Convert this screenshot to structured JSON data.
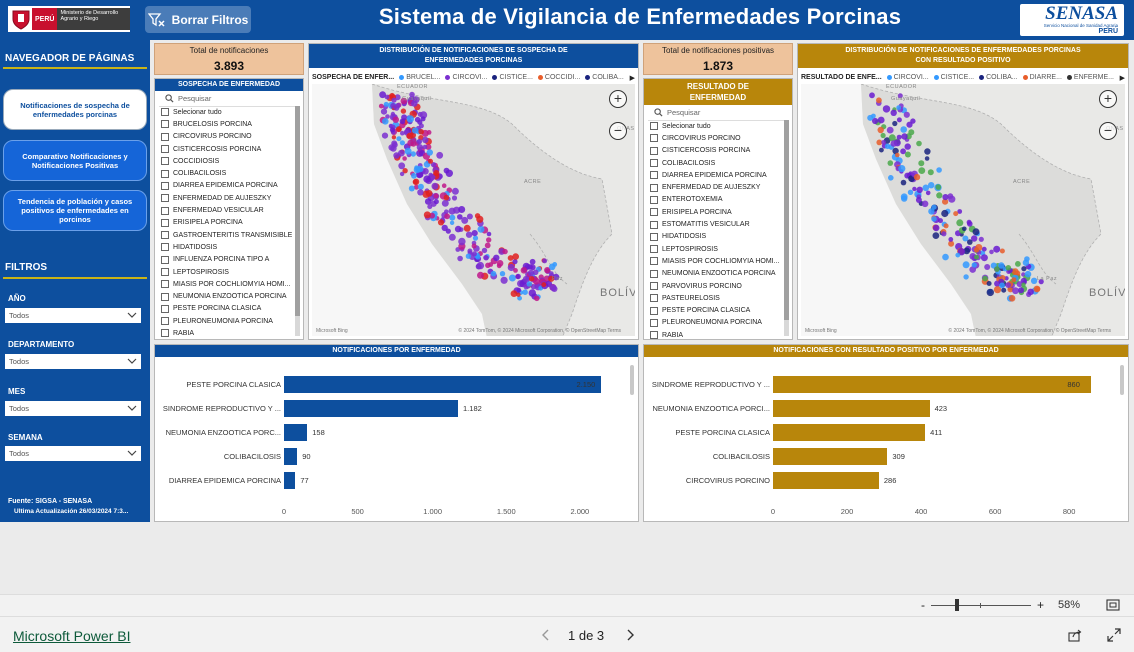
{
  "header": {
    "title": "Sistema de Vigilancia de Enfermedades Porcinas",
    "clear_filters": "Borrar Filtros",
    "gov_logo": {
      "country": "PERÚ",
      "ministry": "Ministerio de Desarrollo Agrario y Riego"
    },
    "senasa_logo": {
      "name": "SENASA",
      "subtitle": "Servicio Nacional de Sanidad Agraria",
      "country": "PERÚ"
    }
  },
  "sidebar": {
    "nav_heading": "NAVEGADOR DE PÁGINAS",
    "nav_items": [
      {
        "label": "Notificaciones de sospecha de enfermedades porcinas",
        "active": true
      },
      {
        "label": "Comparativo Notificaciones y Notificaciones Positivas",
        "active": false
      },
      {
        "label": "Tendencia de población y casos positivos de enfermedades en porcinos",
        "active": false
      }
    ],
    "filters_heading": "FILTROS",
    "filters": [
      {
        "label": "AÑO",
        "value": "Todos"
      },
      {
        "label": "DEPARTAMENTO",
        "value": "Todos"
      },
      {
        "label": "MES",
        "value": "Todos"
      },
      {
        "label": "SEMANA",
        "value": "Todos"
      }
    ],
    "source": "Fuente: SIGSA - SENASA",
    "last_update": "Última Actualización 26/03/2024 7:3..."
  },
  "kpis": {
    "total": {
      "label": "Total de notificaciones",
      "value": "3.893"
    },
    "positive": {
      "label": "Total de notificaciones positivas",
      "value": "1.873"
    }
  },
  "slicer_suspect": {
    "title": "SOSPECHA DE ENFERMEDAD",
    "search_placeholder": "Pesquisar",
    "items": [
      "Selecionar tudo",
      "BRUCELOSIS PORCINA",
      "CIRCOVIRUS PORCINO",
      "CISTICERCOSIS PORCINA",
      "COCCIDIOSIS",
      "COLIBACILOSIS",
      "DIARREA EPIDEMICA PORCINA",
      "ENFERMEDAD DE AUJESZKY",
      "ENFERMEDAD VESICULAR",
      "ERISIPELA PORCINA",
      "GASTROENTERITIS TRANSMISIBLE",
      "HIDATIDOSIS",
      "INFLUENZA PORCINA TIPO A",
      "LEPTOSPIROSIS",
      "MIASIS POR COCHLIOMYIA HOMI...",
      "NEUMONIA ENZOOTICA PORCINA",
      "PESTE PORCINA CLASICA",
      "PLEURONEUMONIA PORCINA",
      "RABIA"
    ]
  },
  "slicer_result": {
    "title": "RESULTADO DE ENFERMEDAD",
    "search_placeholder": "Pesquisar",
    "items": [
      "Selecionar tudo",
      "CIRCOVIRUS PORCINO",
      "CISTICERCOSIS PORCINA",
      "COLIBACILOSIS",
      "DIARREA EPIDEMICA PORCINA",
      "ENFERMEDAD DE AUJESZKY",
      "ENTEROTOXEMIA",
      "ERISIPELA PORCINA",
      "ESTOMATITIS VESICULAR",
      "HIDATIDOSIS",
      "LEPTOSPIROSIS",
      "MIASIS POR COCHLIOMYIA HOMI...",
      "NEUMONIA ENZOOTICA PORCINA",
      "PARVOVIRUS PORCINO",
      "PASTEURELOSIS",
      "PESTE PORCINA CLASICA",
      "PLEURONEUMONIA PORCINA",
      "RABIA"
    ]
  },
  "map_suspect": {
    "title": "DISTRIBUCIÓN DE NOTIFICACIONES DE SOSPECHA DE ENFERMEDADES PORCINAS",
    "legend_title": "SOSPECHA DE ENFER...",
    "legend": [
      {
        "name": "BRUCEL...",
        "color": "#3399ff"
      },
      {
        "name": "CIRCOVI...",
        "color": "#7b2fd0"
      },
      {
        "name": "CISTICE...",
        "color": "#1a237e"
      },
      {
        "name": "COCCIDI...",
        "color": "#e85d2a"
      },
      {
        "name": "COLIBA...",
        "color": "#1a237e"
      }
    ],
    "labels": {
      "country_n": "ECUADOR",
      "city_n": "Guayaquil",
      "country_e": "BOLÍV",
      "region": "ACRE",
      "region2": "ONAS",
      "city_s": "Paz"
    },
    "bing": "Microsoft Bing",
    "credits": "© 2024 TomTom, © 2024 Microsoft Corporation, © OpenStreetMap  Terms"
  },
  "map_result": {
    "title": "DISTRIBUCIÓN DE NOTIFICACIONES DE ENFERMEDADES PORCINAS CON RESULTADO POSITIVO",
    "legend_title": "RESULTADO DE ENFE...",
    "legend": [
      {
        "name": "CIRCOVI...",
        "color": "#3399ff"
      },
      {
        "name": "CISTICE...",
        "color": "#3399ff"
      },
      {
        "name": "COLIBA...",
        "color": "#1a237e"
      },
      {
        "name": "DIARRE...",
        "color": "#e85d2a"
      },
      {
        "name": "ENFERME...",
        "color": "#333333"
      }
    ],
    "labels": {
      "country_n": "ECUADOR",
      "city_n": "Guayaquil",
      "country_e": "BOLÍV",
      "region": "ACRE",
      "region2": "ONAS",
      "city_s": "La Paz"
    },
    "bing": "Microsoft Bing",
    "credits": "© 2024 TomTom, © 2024 Microsoft Corporation, © OpenStreetMap  Terms"
  },
  "chart_data": [
    {
      "type": "bar",
      "orientation": "horizontal",
      "title": "NOTIFICACIONES POR ENFERMEDAD",
      "categories": [
        "PESTE PORCINA CLASICA",
        "SINDROME REPRODUCTIVO Y ...",
        "NEUMONIA ENZOOTICA PORC...",
        "COLIBACILOSIS",
        "DIARREA EPIDEMICA PORCINA"
      ],
      "values": [
        2150,
        1182,
        158,
        90,
        77
      ],
      "value_labels": [
        "2.150",
        "1.182",
        "158",
        "90",
        "77"
      ],
      "xlim": [
        0,
        2350
      ],
      "ticks": [
        0,
        500,
        1000,
        1500,
        2000
      ],
      "tick_labels": [
        "0",
        "500",
        "1.000",
        "1.500",
        "2.000"
      ],
      "color": "#0d4f9e"
    },
    {
      "type": "bar",
      "orientation": "horizontal",
      "title": "NOTIFICACIONES CON RESULTADO POSITIVO POR ENFERMEDAD",
      "categories": [
        "SINDROME REPRODUCTIVO Y ...",
        "NEUMONIA ENZOOTICA PORCI...",
        "PESTE PORCINA CLASICA",
        "COLIBACILOSIS",
        "CIRCOVIRUS PORCINO"
      ],
      "values": [
        860,
        423,
        411,
        309,
        286
      ],
      "value_labels": [
        "860",
        "423",
        "411",
        "309",
        "286"
      ],
      "xlim": [
        0,
        940
      ],
      "ticks": [
        0,
        200,
        400,
        600,
        800
      ],
      "tick_labels": [
        "0",
        "200",
        "400",
        "600",
        "800"
      ],
      "color": "#b8860b"
    }
  ],
  "zoom": {
    "minus": "-",
    "plus": "+",
    "percent": "58%"
  },
  "footer": {
    "powerbi": "Microsoft Power BI",
    "page_indicator": "1 de 3"
  }
}
